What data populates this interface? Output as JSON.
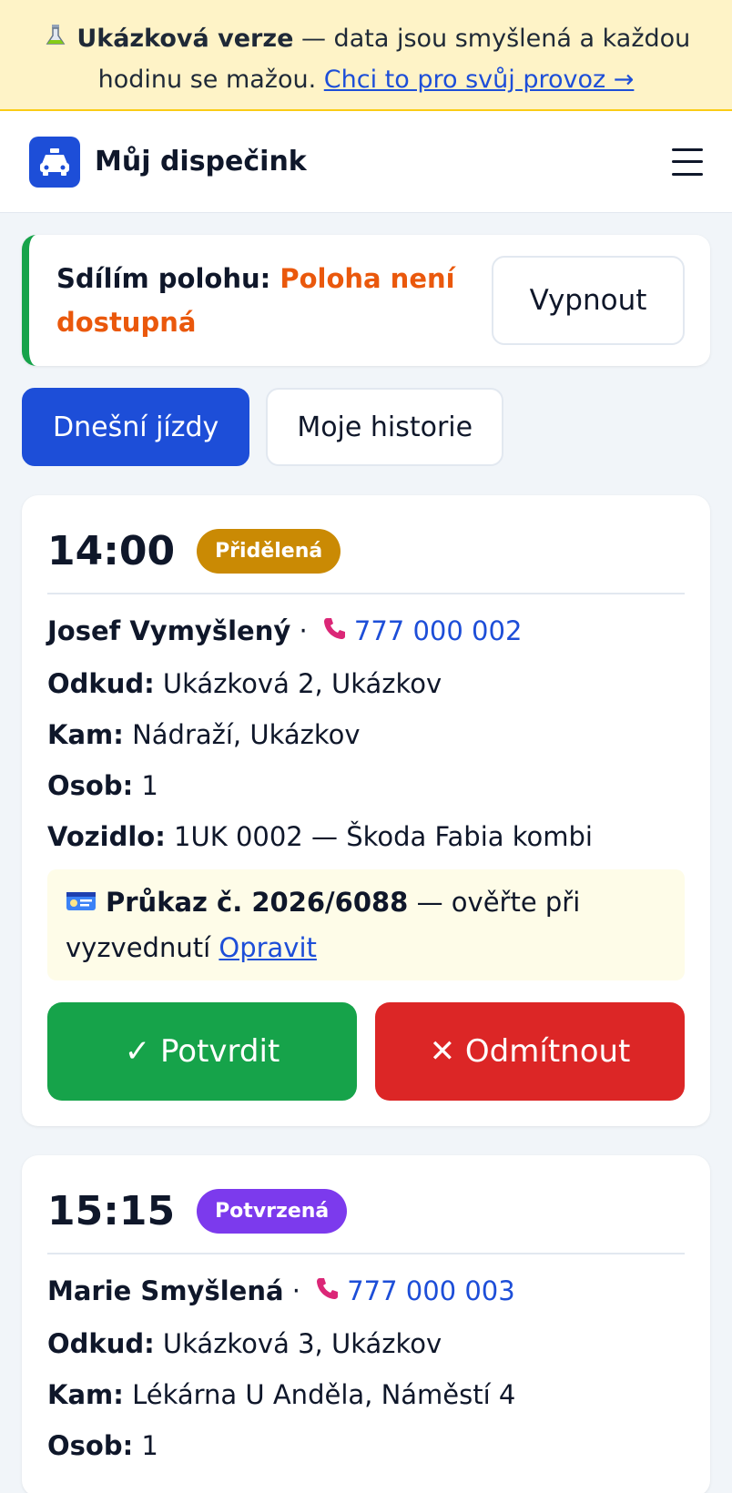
{
  "banner": {
    "icon": "test-tube-icon",
    "bold": "Ukázková verze",
    "text": " — data jsou smyšlená a každou hodinu se mažou. ",
    "link": "Chci to pro svůj provoz →"
  },
  "header": {
    "brand": "Můj dispečink",
    "logo_icon": "taxi-icon",
    "menu_icon": "hamburger-icon"
  },
  "location": {
    "label": "Sdílím polohu:",
    "status": "Poloha není dostupná",
    "off_button": "Vypnout",
    "accent": "#16a34a",
    "status_color": "#ea580c"
  },
  "tabs": [
    {
      "label": "Dnešní jízdy",
      "active": true
    },
    {
      "label": "Moje historie",
      "active": false
    }
  ],
  "rides": [
    {
      "time": "14:00",
      "status": "Přidělená",
      "status_color": "#ca8a04",
      "name": "Josef Vymyšlený",
      "phone": "777 000 002",
      "from_label": "Odkud:",
      "from": "Ukázková 2, Ukázkov",
      "to_label": "Kam:",
      "to": "Nádraží, Ukázkov",
      "persons_label": "Osob:",
      "persons": "1",
      "vehicle_label": "Vozidlo:",
      "vehicle": "1UK 0002 — Škoda Fabia kombi",
      "permit_bold": "Průkaz č. 2026/6088",
      "permit_text": " — ověřte při vyzvednutí ",
      "permit_link": "Opravit",
      "confirm": "✓ Potvrdit",
      "reject": "✕ Odmítnout"
    },
    {
      "time": "15:15",
      "status": "Potvrzená",
      "status_color": "#7c3aed",
      "name": "Marie Smyšlená",
      "phone": "777 000 003",
      "from_label": "Odkud:",
      "from": "Ukázková 3, Ukázkov",
      "to_label": "Kam:",
      "to": "Lékárna U Anděla, Náměstí 4",
      "persons_label": "Osob:",
      "persons": "1"
    }
  ]
}
